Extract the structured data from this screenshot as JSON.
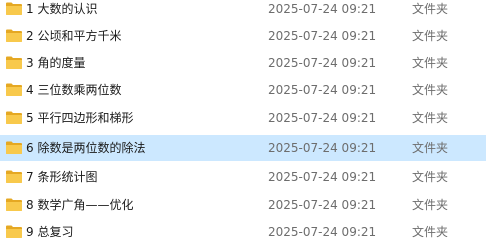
{
  "rows": [
    {
      "name": "1 大数的认识",
      "modified": "2025-07-24 09:21",
      "type": "文件夹",
      "icon": "folder-icon",
      "selected": false
    },
    {
      "name": "2 公顷和平方千米",
      "modified": "2025-07-24 09:21",
      "type": "文件夹",
      "icon": "folder-icon",
      "selected": false
    },
    {
      "name": "3 角的度量",
      "modified": "2025-07-24 09:21",
      "type": "文件夹",
      "icon": "folder-icon",
      "selected": false
    },
    {
      "name": "4 三位数乘两位数",
      "modified": "2025-07-24 09:21",
      "type": "文件夹",
      "icon": "folder-icon",
      "selected": false
    },
    {
      "name": "5 平行四边形和梯形",
      "modified": "2025-07-24 09:21",
      "type": "文件夹",
      "icon": "folder-icon",
      "selected": false
    },
    {
      "name": "6 除数是两位数的除法",
      "modified": "2025-07-24 09:21",
      "type": "文件夹",
      "icon": "folder-icon",
      "selected": true
    },
    {
      "name": "7 条形统计图",
      "modified": "2025-07-24 09:21",
      "type": "文件夹",
      "icon": "folder-icon",
      "selected": false
    },
    {
      "name": "8 数学广角——优化",
      "modified": "2025-07-24 09:21",
      "type": "文件夹",
      "icon": "folder-icon",
      "selected": false
    },
    {
      "name": "9 总复习",
      "modified": "2025-07-24 09:21",
      "type": "文件夹",
      "icon": "folder-icon",
      "selected": false
    }
  ],
  "colors": {
    "selection": "#cce8ff",
    "folder_body": "#f8c94c",
    "folder_tab": "#e5a823"
  }
}
